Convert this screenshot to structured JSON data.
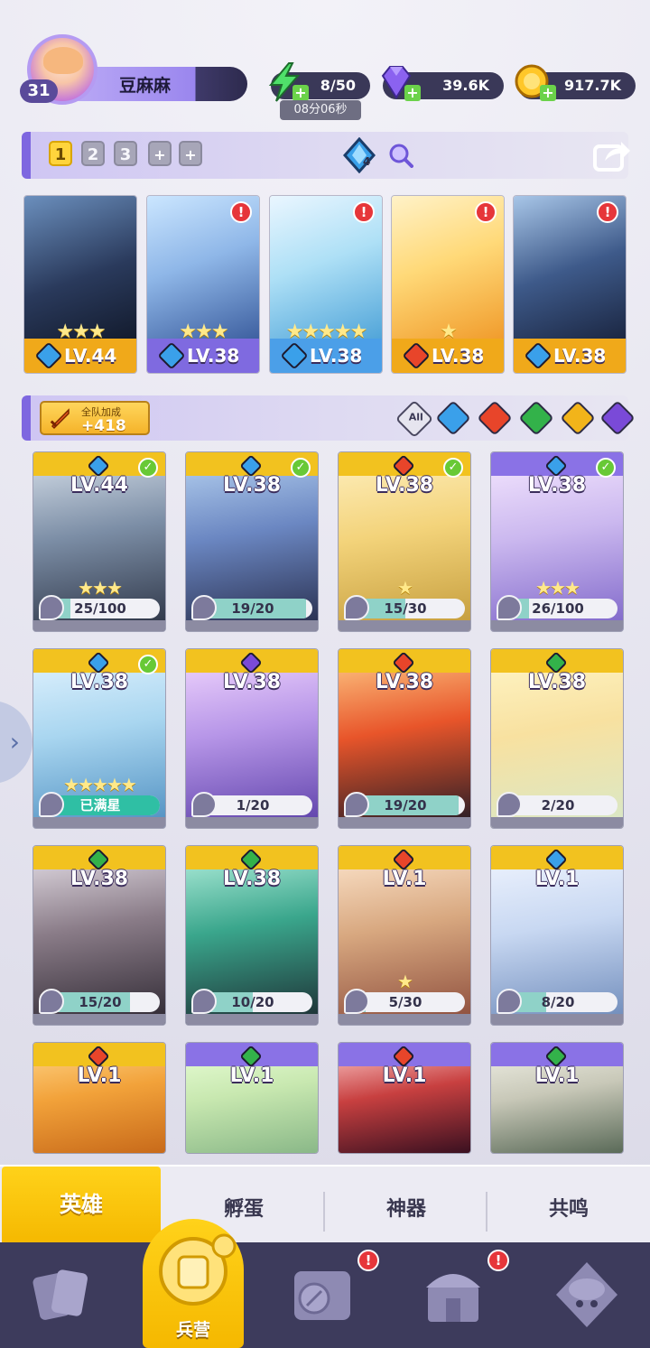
{
  "player": {
    "name": "豆麻麻",
    "level": "31"
  },
  "resources": {
    "energy": "8/50",
    "energy_timer": "08分06秒",
    "gems": "39.6K",
    "gold": "917.7K"
  },
  "team": {
    "slots": [
      "1",
      "2",
      "3"
    ],
    "add_labels": [
      "+",
      "+"
    ],
    "gem_count": "4"
  },
  "lineup": [
    {
      "level": "LV.44",
      "stars": "★★★",
      "element": "water",
      "alert": false,
      "foot_color": "#f0a91a"
    },
    {
      "level": "LV.38",
      "stars": "★★★",
      "element": "water",
      "alert": true,
      "foot_color": "#7f6ae0"
    },
    {
      "level": "LV.38",
      "stars": "★★★★★",
      "element": "water",
      "alert": true,
      "foot_color": "#4b9fe8"
    },
    {
      "level": "LV.38",
      "stars": "★",
      "element": "fire",
      "alert": true,
      "foot_color": "#f0a91a"
    },
    {
      "level": "LV.38",
      "stars": "",
      "element": "water",
      "alert": true,
      "foot_color": "#f0a91a"
    }
  ],
  "filter": {
    "bonus_label": "全队加成",
    "bonus_value": "+418",
    "all_label": "All",
    "elements": [
      "water",
      "fire",
      "wind",
      "light",
      "dark"
    ]
  },
  "heroes": [
    {
      "level": "LV.44",
      "element": "water",
      "check": true,
      "stars": "★★★",
      "shards": "25/100",
      "progress": 0.25,
      "frame": "gold"
    },
    {
      "level": "LV.38",
      "element": "water",
      "check": true,
      "stars": "",
      "shards": "19/20",
      "progress": 0.95,
      "frame": "gold"
    },
    {
      "level": "LV.38",
      "element": "fire",
      "check": true,
      "stars": "★",
      "shards": "15/30",
      "progress": 0.5,
      "frame": "gold"
    },
    {
      "level": "LV.38",
      "element": "water",
      "check": true,
      "stars": "★★★",
      "shards": "26/100",
      "progress": 0.26,
      "frame": "purple"
    },
    {
      "level": "LV.38",
      "element": "water",
      "check": true,
      "stars": "★★★★★",
      "shards": "已满星",
      "progress": 1.0,
      "frame": "gold"
    },
    {
      "level": "LV.38",
      "element": "dark",
      "check": false,
      "stars": "",
      "shards": "1/20",
      "progress": 0.05,
      "frame": "gold"
    },
    {
      "level": "LV.38",
      "element": "fire",
      "check": false,
      "stars": "",
      "shards": "19/20",
      "progress": 0.95,
      "frame": "gold"
    },
    {
      "level": "LV.38",
      "element": "wind",
      "check": false,
      "stars": "",
      "shards": "2/20",
      "progress": 0.1,
      "frame": "gold"
    },
    {
      "level": "LV.38",
      "element": "wind",
      "check": false,
      "stars": "",
      "shards": "15/20",
      "progress": 0.75,
      "frame": "gold"
    },
    {
      "level": "LV.38",
      "element": "wind",
      "check": false,
      "stars": "",
      "shards": "10/20",
      "progress": 0.5,
      "frame": "gold"
    },
    {
      "level": "LV.1",
      "element": "fire",
      "check": false,
      "stars": "★",
      "shards": "5/30",
      "progress": 0.17,
      "frame": "gold"
    },
    {
      "level": "LV.1",
      "element": "water",
      "check": false,
      "stars": "",
      "shards": "8/20",
      "progress": 0.4,
      "frame": "gold"
    },
    {
      "level": "LV.1",
      "element": "fire",
      "check": false,
      "stars": "",
      "shards": "",
      "progress": 0,
      "frame": "gold"
    },
    {
      "level": "LV.1",
      "element": "wind",
      "check": false,
      "stars": "",
      "shards": "",
      "progress": 0,
      "frame": "purple"
    },
    {
      "level": "LV.1",
      "element": "fire",
      "check": false,
      "stars": "",
      "shards": "",
      "progress": 0,
      "frame": "purple"
    },
    {
      "level": "LV.1",
      "element": "wind",
      "check": false,
      "stars": "",
      "shards": "",
      "progress": 0,
      "frame": "purple"
    }
  ],
  "tabs": {
    "active": "英雄",
    "items": [
      "孵蛋",
      "神器",
      "共鸣"
    ]
  },
  "nav": {
    "active_label": "兵营",
    "items": [
      "cards-icon",
      "barracks-icon",
      "map-icon",
      "temple-icon",
      "summon-icon"
    ]
  },
  "colors": {
    "water": "#3aa0ea",
    "fire": "#e8452a",
    "wind": "#33b24a",
    "light": "#f2b41a",
    "dark": "#7a4ad8",
    "gold_frame": "#f2c21f",
    "purple_frame": "#8a72e6",
    "accent": "#ffd21a"
  }
}
